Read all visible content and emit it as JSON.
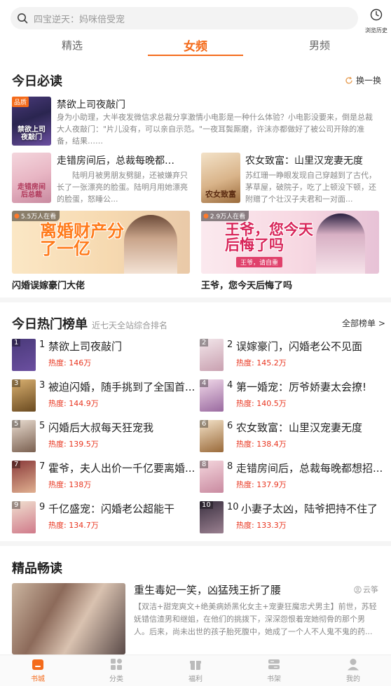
{
  "search": {
    "placeholder": "四宝逆天：妈咪倍受宠"
  },
  "history": {
    "label": "浏览历史"
  },
  "tabs": [
    {
      "label": "精选",
      "active": false
    },
    {
      "label": "女频",
      "active": true
    },
    {
      "label": "男频",
      "active": false
    }
  ],
  "today_must_read": {
    "title": "今日必读",
    "refresh_label": "换一换",
    "featured": {
      "badge": "品质",
      "cover_text": "禁欲上司夜敲门",
      "title": "禁欲上司夜敲门",
      "desc": "身为小助理，大半夜发微信求总裁分享激情小电影是一种什么体验？小电影没要来，倒是总裁大人夜敲门：\"片儿没有，可以亲自示范。\"一夜耳鬓厮磨，许沫亦都做好了被公司开除的准备，结果……"
    },
    "books": [
      {
        "cover_text": "走错房间后总裁",
        "title": "走错房间后，总裁每晚都想招...",
        "desc": "陆明月被男朋友劈腿，还被嫌弃只长了一张漂亮的脸蛋。陆明月用她漂亮的脸蛋，怒睡公..."
      },
      {
        "cover_text": "农女致富",
        "title": "农女致富：山里汉宠妻无度",
        "desc": "苏红珊一睁眼发现自己穿越到了古代，茅草屋，破院子，吃了上顿没下顿，还附赠了个壮汉子夫君和一对面..."
      }
    ],
    "banners": [
      {
        "readers": "5.5万人在看",
        "big_text": "离婚财产分了一亿",
        "caption": "闪婚误嫁豪门大佬"
      },
      {
        "readers": "2.9万人在看",
        "big_text": "王爷，您今天后悔了吗",
        "small_text": "王爷，请自重",
        "caption": "王爷，您今天后悔了吗"
      }
    ]
  },
  "hot_ranking": {
    "title": "今日热门榜单",
    "subtitle": "近七天全站综合排名",
    "all_label": "全部榜单 >",
    "items": [
      {
        "rank": "1",
        "title": "禁欲上司夜敲门",
        "heat": "热度: 146万"
      },
      {
        "rank": "2",
        "title": "误嫁豪门，闪婚老公不见面",
        "heat": "热度: 145.2万"
      },
      {
        "rank": "3",
        "title": "被迫闪婚，随手挑到了全国首...",
        "heat": "热度: 144.9万"
      },
      {
        "rank": "4",
        "title": "第一婚宠：厉爷娇妻太会撩!",
        "heat": "热度: 140.5万"
      },
      {
        "rank": "5",
        "title": "闪婚后大叔每天狂宠我",
        "heat": "热度: 139.5万"
      },
      {
        "rank": "6",
        "title": "农女致富：山里汉宠妻无度",
        "heat": "热度: 138.4万"
      },
      {
        "rank": "7",
        "title": "霍爷，夫人出价一千亿要离婚...",
        "heat": "热度: 138万"
      },
      {
        "rank": "8",
        "title": "走错房间后，总裁每晚都想招...",
        "heat": "热度: 137.9万"
      },
      {
        "rank": "9",
        "title": "千亿盛宠：闪婚老公超能干",
        "heat": "热度: 134.7万"
      },
      {
        "rank": "10",
        "title": "小妻子太凶，陆爷把持不住了",
        "heat": "热度: 133.3万"
      }
    ]
  },
  "premium": {
    "title": "精品畅读",
    "book": {
      "title": "重生毒妃一笑，凶猛残王折了腰",
      "author": "云筝",
      "desc": "【双洁+甜宠爽文+绝美病娇黑化女主+宠妻狂魔忠犬男主】前世，苏轻妩错信渣男和继姐，在他们的挑拨下，深深怨恨着宠她彻骨的那个男人。后来，尚未出世的孩子胎死腹中，她成了一个人不人鬼不鬼的药..."
    }
  },
  "bottom_nav": [
    {
      "label": "书城",
      "icon": "bookstore-icon",
      "active": true
    },
    {
      "label": "分类",
      "icon": "category-icon",
      "active": false
    },
    {
      "label": "福利",
      "icon": "gift-icon",
      "active": false
    },
    {
      "label": "书架",
      "icon": "bookshelf-icon",
      "active": false
    },
    {
      "label": "我的",
      "icon": "profile-icon",
      "active": false
    }
  ],
  "colors": {
    "accent": "#f46b1b",
    "heat": "#e8341e",
    "divider": "#f5f5f5"
  }
}
